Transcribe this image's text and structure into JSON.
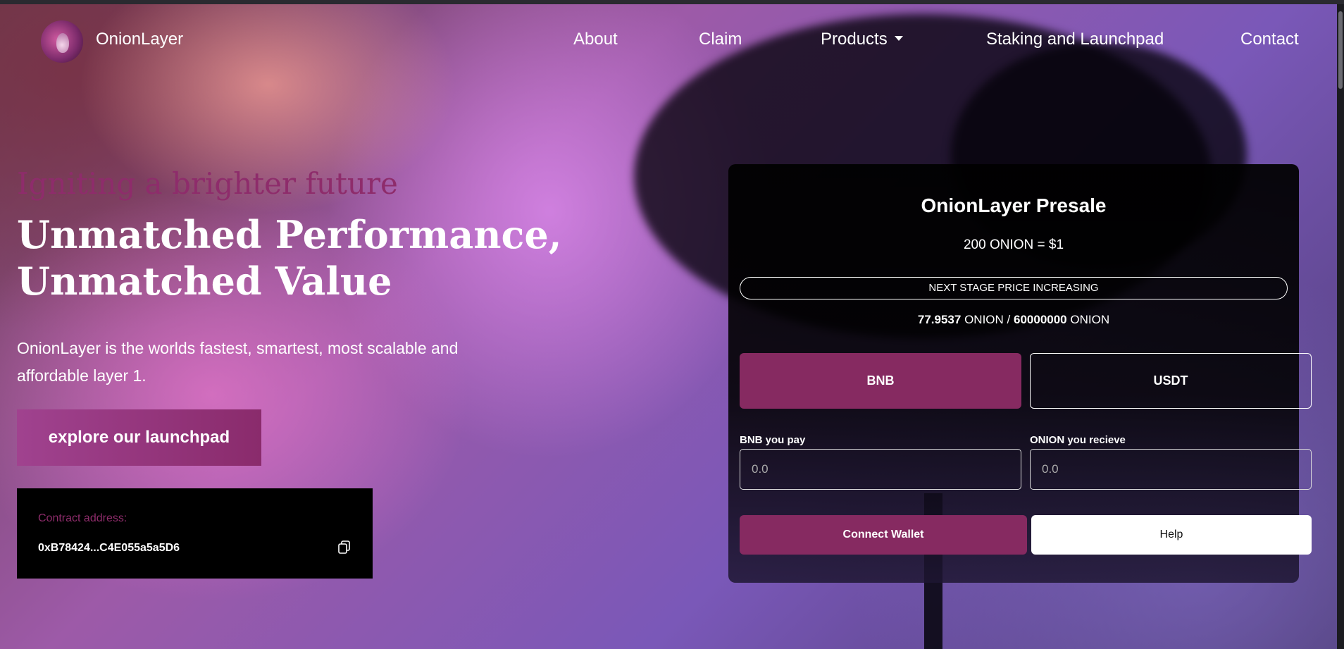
{
  "nav": {
    "brand": "OnionLayer",
    "links": [
      "About",
      "Claim",
      "Products",
      "Staking and Launchpad",
      "Contact"
    ]
  },
  "hero": {
    "tagline": "Igniting a brighter future",
    "headline": "Unmatched Performance, Unmatched Value",
    "description": "OnionLayer is the worlds fastest, smartest, most scalable and affordable layer 1.",
    "explore_label": "explore our launchpad"
  },
  "contract": {
    "label": "Contract address:",
    "address": "0xB78424...C4E055a5a5D6"
  },
  "presale": {
    "title": "OnionLayer Presale",
    "price": "200 ONION = $1",
    "stage_note": "NEXT STAGE PRICE INCREASING",
    "sold": "77.9537",
    "sold_unit": "ONION",
    "separator": "/",
    "total": "60000000",
    "total_unit": "ONION",
    "tabs": [
      "BNB",
      "USDT"
    ],
    "pay_label": "BNB you pay",
    "pay_placeholder": "0.0",
    "receive_label": "ONION you recieve",
    "receive_placeholder": "0.0",
    "connect_label": "Connect Wallet",
    "help_label": "Help"
  },
  "colors": {
    "accent": "#862a61",
    "tagline": "#8e2c6b"
  }
}
